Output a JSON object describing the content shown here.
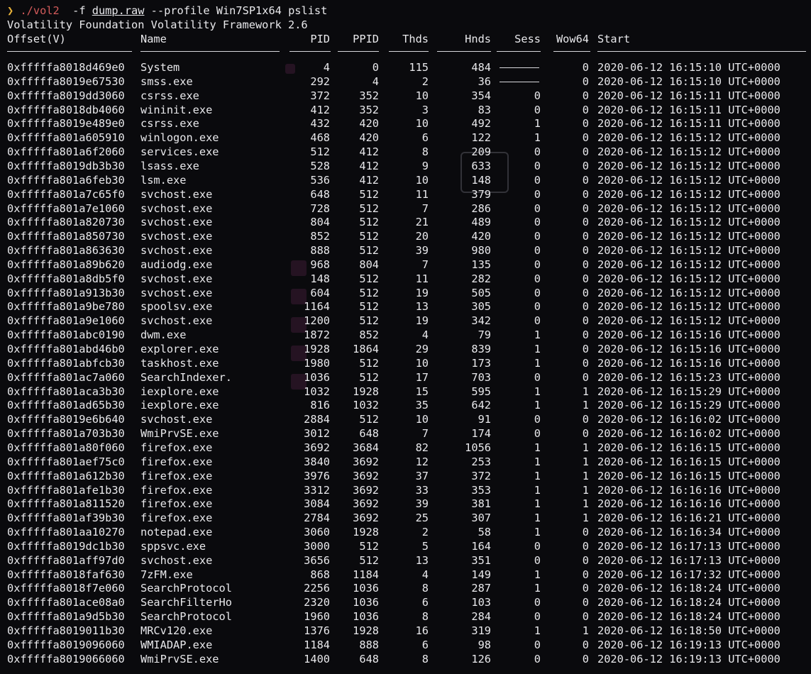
{
  "prompt": {
    "arrow": "❯",
    "program": "./vol2",
    "flag_f": "-f",
    "file": "dump.raw",
    "rest": "--profile Win7SP1x64 pslist"
  },
  "banner": "Volatility Foundation Volatility Framework 2.6",
  "columns": [
    "Offset(V)",
    "Name",
    "PID",
    "PPID",
    "Thds",
    "Hnds",
    "Sess",
    "Wow64",
    "Start"
  ],
  "rows": [
    {
      "offset": "0xfffffa8018d469e0",
      "name": "System",
      "pid": "4",
      "ppid": "0",
      "thds": "115",
      "hnds": "484",
      "sess": "",
      "wow64": "0",
      "start": "2020-06-12 16:15:10 UTC+0000"
    },
    {
      "offset": "0xfffffa8019e67530",
      "name": "smss.exe",
      "pid": "292",
      "ppid": "4",
      "thds": "2",
      "hnds": "36",
      "sess": "",
      "wow64": "0",
      "start": "2020-06-12 16:15:10 UTC+0000"
    },
    {
      "offset": "0xfffffa8019dd3060",
      "name": "csrss.exe",
      "pid": "372",
      "ppid": "352",
      "thds": "10",
      "hnds": "354",
      "sess": "0",
      "wow64": "0",
      "start": "2020-06-12 16:15:11 UTC+0000"
    },
    {
      "offset": "0xfffffa8018db4060",
      "name": "wininit.exe",
      "pid": "412",
      "ppid": "352",
      "thds": "3",
      "hnds": "83",
      "sess": "0",
      "wow64": "0",
      "start": "2020-06-12 16:15:11 UTC+0000"
    },
    {
      "offset": "0xfffffa8019e489e0",
      "name": "csrss.exe",
      "pid": "432",
      "ppid": "420",
      "thds": "10",
      "hnds": "492",
      "sess": "1",
      "wow64": "0",
      "start": "2020-06-12 16:15:11 UTC+0000"
    },
    {
      "offset": "0xfffffa801a605910",
      "name": "winlogon.exe",
      "pid": "468",
      "ppid": "420",
      "thds": "6",
      "hnds": "122",
      "sess": "1",
      "wow64": "0",
      "start": "2020-06-12 16:15:12 UTC+0000"
    },
    {
      "offset": "0xfffffa801a6f2060",
      "name": "services.exe",
      "pid": "512",
      "ppid": "412",
      "thds": "8",
      "hnds": "209",
      "sess": "0",
      "wow64": "0",
      "start": "2020-06-12 16:15:12 UTC+0000"
    },
    {
      "offset": "0xfffffa8019db3b30",
      "name": "lsass.exe",
      "pid": "528",
      "ppid": "412",
      "thds": "9",
      "hnds": "633",
      "sess": "0",
      "wow64": "0",
      "start": "2020-06-12 16:15:12 UTC+0000"
    },
    {
      "offset": "0xfffffa801a6feb30",
      "name": "lsm.exe",
      "pid": "536",
      "ppid": "412",
      "thds": "10",
      "hnds": "148",
      "sess": "0",
      "wow64": "0",
      "start": "2020-06-12 16:15:12 UTC+0000"
    },
    {
      "offset": "0xfffffa801a7c65f0",
      "name": "svchost.exe",
      "pid": "648",
      "ppid": "512",
      "thds": "11",
      "hnds": "379",
      "sess": "0",
      "wow64": "0",
      "start": "2020-06-12 16:15:12 UTC+0000"
    },
    {
      "offset": "0xfffffa801a7e1060",
      "name": "svchost.exe",
      "pid": "728",
      "ppid": "512",
      "thds": "7",
      "hnds": "286",
      "sess": "0",
      "wow64": "0",
      "start": "2020-06-12 16:15:12 UTC+0000"
    },
    {
      "offset": "0xfffffa801a820730",
      "name": "svchost.exe",
      "pid": "804",
      "ppid": "512",
      "thds": "21",
      "hnds": "489",
      "sess": "0",
      "wow64": "0",
      "start": "2020-06-12 16:15:12 UTC+0000"
    },
    {
      "offset": "0xfffffa801a850730",
      "name": "svchost.exe",
      "pid": "852",
      "ppid": "512",
      "thds": "20",
      "hnds": "420",
      "sess": "0",
      "wow64": "0",
      "start": "2020-06-12 16:15:12 UTC+0000"
    },
    {
      "offset": "0xfffffa801a863630",
      "name": "svchost.exe",
      "pid": "888",
      "ppid": "512",
      "thds": "39",
      "hnds": "980",
      "sess": "0",
      "wow64": "0",
      "start": "2020-06-12 16:15:12 UTC+0000"
    },
    {
      "offset": "0xfffffa801a89b620",
      "name": "audiodg.exe",
      "pid": "968",
      "ppid": "804",
      "thds": "7",
      "hnds": "135",
      "sess": "0",
      "wow64": "0",
      "start": "2020-06-12 16:15:12 UTC+0000"
    },
    {
      "offset": "0xfffffa801a8db5f0",
      "name": "svchost.exe",
      "pid": "148",
      "ppid": "512",
      "thds": "11",
      "hnds": "282",
      "sess": "0",
      "wow64": "0",
      "start": "2020-06-12 16:15:12 UTC+0000"
    },
    {
      "offset": "0xfffffa801a913b30",
      "name": "svchost.exe",
      "pid": "604",
      "ppid": "512",
      "thds": "19",
      "hnds": "505",
      "sess": "0",
      "wow64": "0",
      "start": "2020-06-12 16:15:12 UTC+0000"
    },
    {
      "offset": "0xfffffa801a9be780",
      "name": "spoolsv.exe",
      "pid": "1164",
      "ppid": "512",
      "thds": "13",
      "hnds": "305",
      "sess": "0",
      "wow64": "0",
      "start": "2020-06-12 16:15:12 UTC+0000"
    },
    {
      "offset": "0xfffffa801a9e1060",
      "name": "svchost.exe",
      "pid": "1200",
      "ppid": "512",
      "thds": "19",
      "hnds": "342",
      "sess": "0",
      "wow64": "0",
      "start": "2020-06-12 16:15:12 UTC+0000"
    },
    {
      "offset": "0xfffffa801abc0190",
      "name": "dwm.exe",
      "pid": "1872",
      "ppid": "852",
      "thds": "4",
      "hnds": "79",
      "sess": "1",
      "wow64": "0",
      "start": "2020-06-12 16:15:16 UTC+0000"
    },
    {
      "offset": "0xfffffa801abd46b0",
      "name": "explorer.exe",
      "pid": "1928",
      "ppid": "1864",
      "thds": "29",
      "hnds": "839",
      "sess": "1",
      "wow64": "0",
      "start": "2020-06-12 16:15:16 UTC+0000"
    },
    {
      "offset": "0xfffffa801abfcb30",
      "name": "taskhost.exe",
      "pid": "1980",
      "ppid": "512",
      "thds": "10",
      "hnds": "173",
      "sess": "1",
      "wow64": "0",
      "start": "2020-06-12 16:15:16 UTC+0000"
    },
    {
      "offset": "0xfffffa801ac7a060",
      "name": "SearchIndexer.",
      "pid": "1036",
      "ppid": "512",
      "thds": "17",
      "hnds": "703",
      "sess": "0",
      "wow64": "0",
      "start": "2020-06-12 16:15:23 UTC+0000"
    },
    {
      "offset": "0xfffffa801aca3b30",
      "name": "iexplore.exe",
      "pid": "1032",
      "ppid": "1928",
      "thds": "15",
      "hnds": "595",
      "sess": "1",
      "wow64": "1",
      "start": "2020-06-12 16:15:29 UTC+0000"
    },
    {
      "offset": "0xfffffa801ad65b30",
      "name": "iexplore.exe",
      "pid": "816",
      "ppid": "1032",
      "thds": "35",
      "hnds": "642",
      "sess": "1",
      "wow64": "1",
      "start": "2020-06-12 16:15:29 UTC+0000"
    },
    {
      "offset": "0xfffffa8019e6b640",
      "name": "svchost.exe",
      "pid": "2884",
      "ppid": "512",
      "thds": "10",
      "hnds": "91",
      "sess": "0",
      "wow64": "0",
      "start": "2020-06-12 16:16:02 UTC+0000"
    },
    {
      "offset": "0xfffffa801a703b30",
      "name": "WmiPrvSE.exe",
      "pid": "3012",
      "ppid": "648",
      "thds": "7",
      "hnds": "174",
      "sess": "0",
      "wow64": "0",
      "start": "2020-06-12 16:16:02 UTC+0000"
    },
    {
      "offset": "0xfffffa801a80f060",
      "name": "firefox.exe",
      "pid": "3692",
      "ppid": "3684",
      "thds": "82",
      "hnds": "1056",
      "sess": "1",
      "wow64": "1",
      "start": "2020-06-12 16:16:15 UTC+0000"
    },
    {
      "offset": "0xfffffa801aef75c0",
      "name": "firefox.exe",
      "pid": "3840",
      "ppid": "3692",
      "thds": "12",
      "hnds": "253",
      "sess": "1",
      "wow64": "1",
      "start": "2020-06-12 16:16:15 UTC+0000"
    },
    {
      "offset": "0xfffffa801a612b30",
      "name": "firefox.exe",
      "pid": "3976",
      "ppid": "3692",
      "thds": "37",
      "hnds": "372",
      "sess": "1",
      "wow64": "1",
      "start": "2020-06-12 16:16:15 UTC+0000"
    },
    {
      "offset": "0xfffffa801afe1b30",
      "name": "firefox.exe",
      "pid": "3312",
      "ppid": "3692",
      "thds": "33",
      "hnds": "353",
      "sess": "1",
      "wow64": "1",
      "start": "2020-06-12 16:16:16 UTC+0000"
    },
    {
      "offset": "0xfffffa801a811520",
      "name": "firefox.exe",
      "pid": "3084",
      "ppid": "3692",
      "thds": "39",
      "hnds": "381",
      "sess": "1",
      "wow64": "1",
      "start": "2020-06-12 16:16:16 UTC+0000"
    },
    {
      "offset": "0xfffffa801af39b30",
      "name": "firefox.exe",
      "pid": "2784",
      "ppid": "3692",
      "thds": "25",
      "hnds": "307",
      "sess": "1",
      "wow64": "1",
      "start": "2020-06-12 16:16:21 UTC+0000"
    },
    {
      "offset": "0xfffffa801aa10270",
      "name": "notepad.exe",
      "pid": "3060",
      "ppid": "1928",
      "thds": "2",
      "hnds": "58",
      "sess": "1",
      "wow64": "0",
      "start": "2020-06-12 16:16:34 UTC+0000"
    },
    {
      "offset": "0xfffffa8019dc1b30",
      "name": "sppsvc.exe",
      "pid": "3000",
      "ppid": "512",
      "thds": "5",
      "hnds": "164",
      "sess": "0",
      "wow64": "0",
      "start": "2020-06-12 16:17:13 UTC+0000"
    },
    {
      "offset": "0xfffffa801aff97d0",
      "name": "svchost.exe",
      "pid": "3656",
      "ppid": "512",
      "thds": "13",
      "hnds": "351",
      "sess": "0",
      "wow64": "0",
      "start": "2020-06-12 16:17:13 UTC+0000"
    },
    {
      "offset": "0xfffffa8018faf630",
      "name": "7zFM.exe",
      "pid": "868",
      "ppid": "1184",
      "thds": "4",
      "hnds": "149",
      "sess": "1",
      "wow64": "0",
      "start": "2020-06-12 16:17:32 UTC+0000"
    },
    {
      "offset": "0xfffffa8018f7e060",
      "name": "SearchProtocol",
      "pid": "2256",
      "ppid": "1036",
      "thds": "8",
      "hnds": "287",
      "sess": "1",
      "wow64": "0",
      "start": "2020-06-12 16:18:24 UTC+0000"
    },
    {
      "offset": "0xfffffa801ace08a0",
      "name": "SearchFilterHo",
      "pid": "2320",
      "ppid": "1036",
      "thds": "6",
      "hnds": "103",
      "sess": "0",
      "wow64": "0",
      "start": "2020-06-12 16:18:24 UTC+0000"
    },
    {
      "offset": "0xfffffa801a9d5b30",
      "name": "SearchProtocol",
      "pid": "1960",
      "ppid": "1036",
      "thds": "8",
      "hnds": "284",
      "sess": "0",
      "wow64": "0",
      "start": "2020-06-12 16:18:24 UTC+0000"
    },
    {
      "offset": "0xfffffa8019011b30",
      "name": "MRCv120.exe",
      "pid": "1376",
      "ppid": "1928",
      "thds": "16",
      "hnds": "319",
      "sess": "1",
      "wow64": "1",
      "start": "2020-06-12 16:18:50 UTC+0000"
    },
    {
      "offset": "0xfffffa8019096060",
      "name": "WMIADAP.exe",
      "pid": "1184",
      "ppid": "888",
      "thds": "6",
      "hnds": "98",
      "sess": "0",
      "wow64": "0",
      "start": "2020-06-12 16:19:13 UTC+0000"
    },
    {
      "offset": "0xfffffa8019066060",
      "name": "WmiPrvSE.exe",
      "pid": "1400",
      "ppid": "648",
      "thds": "8",
      "hnds": "126",
      "sess": "0",
      "wow64": "0",
      "start": "2020-06-12 16:19:13 UTC+0000"
    }
  ]
}
